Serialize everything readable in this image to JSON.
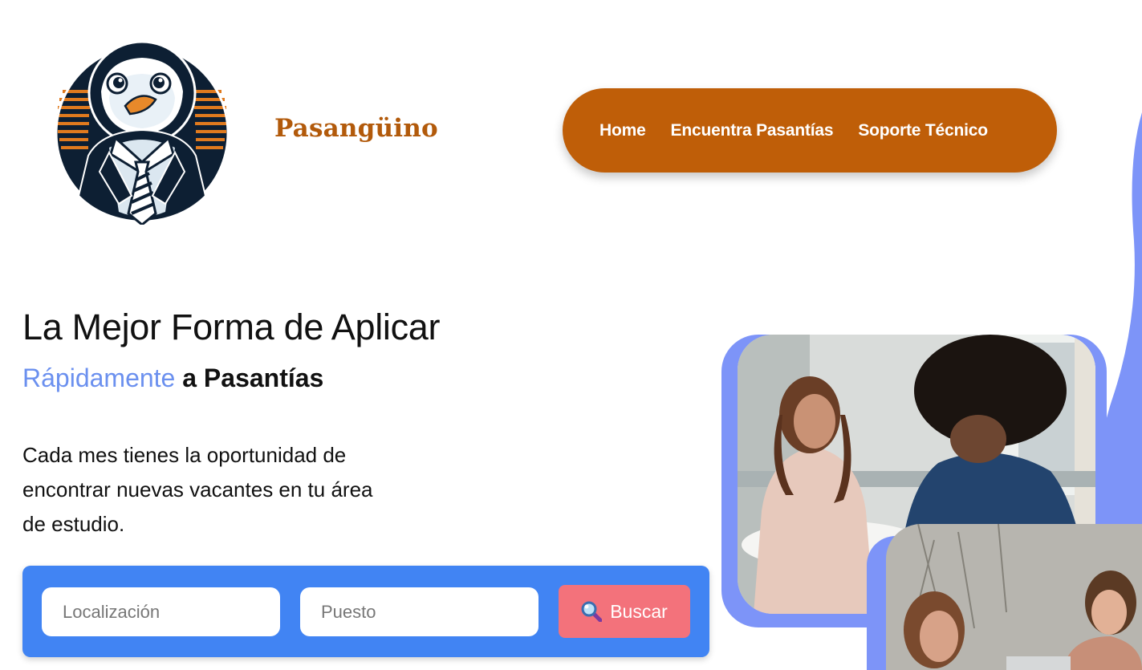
{
  "header": {
    "brand_name": "Pasangüino",
    "logo_icon": "penguin-logo-icon",
    "nav": [
      {
        "label": "Home"
      },
      {
        "label": "Encuentra Pasantías"
      },
      {
        "label": "Soporte Técnico"
      }
    ]
  },
  "hero": {
    "title": "La Mejor Forma de Aplicar",
    "subtitle_accent": "Rápidamente",
    "subtitle_rest": " a Pasantías",
    "description_lines": [
      "Cada mes tienes la oportunidad de",
      "encontrar nuevas vacantes en tu área",
      "de estudio."
    ]
  },
  "search": {
    "location_placeholder": "Localización",
    "location_value": "",
    "position_placeholder": "Puesto",
    "position_value": "",
    "button_label": "Buscar",
    "button_icon": "magnifier-icon"
  },
  "colors": {
    "brand_orange": "#bf5e08",
    "brand_text": "#b25a0b",
    "accent_blue": "#6b90ef",
    "search_blue": "#4184f3",
    "button_pink": "#f3727b",
    "photo_frame": "#7d94f8"
  }
}
